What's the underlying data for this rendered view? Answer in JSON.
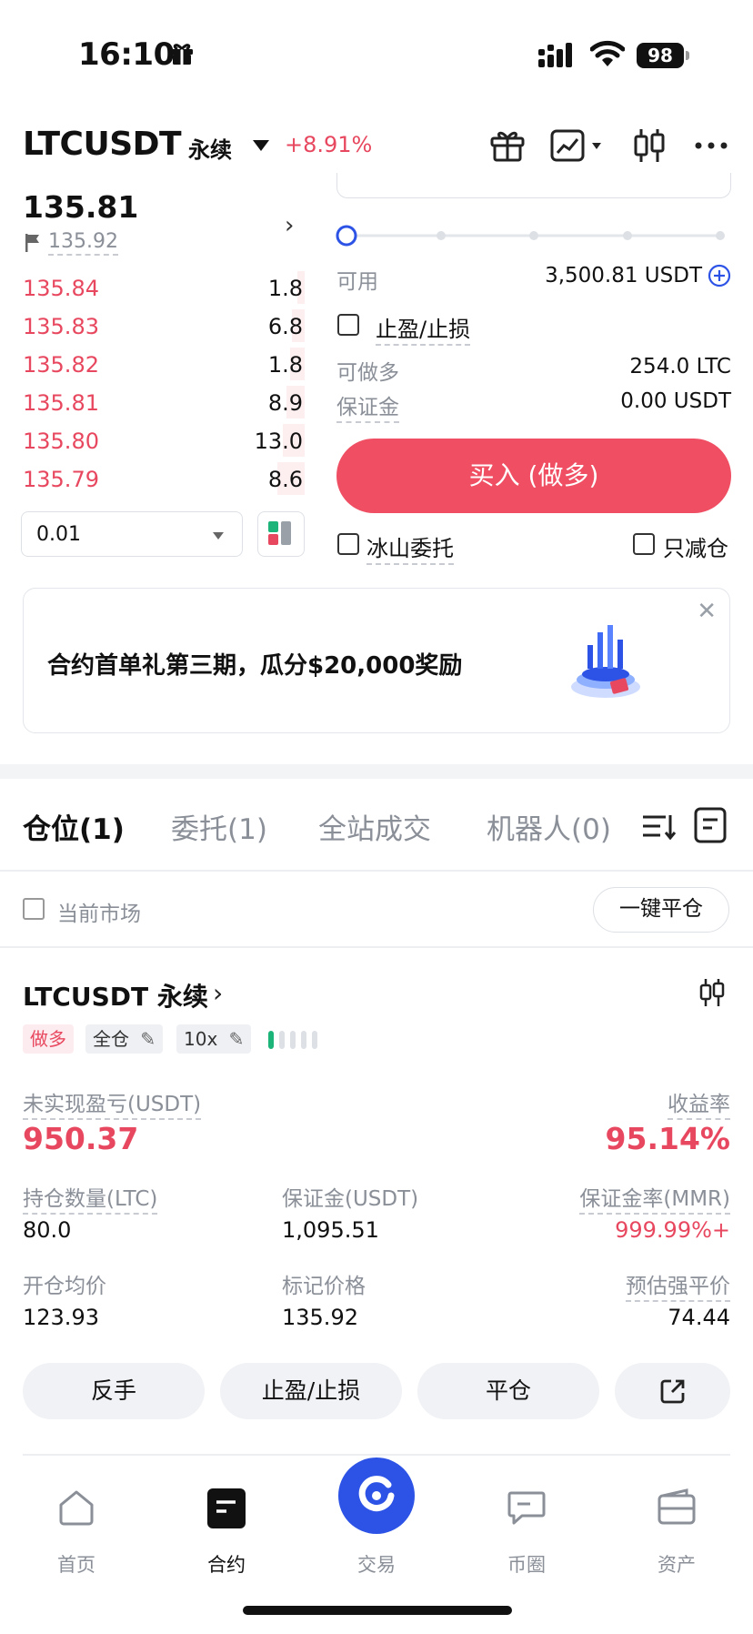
{
  "status_bar": {
    "time": "16:10",
    "battery": "98"
  },
  "header": {
    "pair": "LTCUSDT",
    "contract_type": "永续",
    "change": "+8.91%"
  },
  "orderbook": {
    "last_price": "135.81",
    "mark_price": "135.92",
    "asks": [
      {
        "price": "135.84",
        "qty": "1.8"
      },
      {
        "price": "135.83",
        "qty": "6.8"
      },
      {
        "price": "135.82",
        "qty": "1.8"
      },
      {
        "price": "135.81",
        "qty": "8.9"
      },
      {
        "price": "135.80",
        "qty": "13.0"
      },
      {
        "price": "135.79",
        "qty": "8.6"
      }
    ],
    "precision": "0.01"
  },
  "order_form": {
    "slider_percent": 0,
    "available_label": "可用",
    "available_value": "3,500.81 USDT",
    "tpsl_label": "止盈/止损",
    "max_long_label": "可做多",
    "max_long_value": "254.0 LTC",
    "margin_label": "保证金",
    "margin_value": "0.00 USDT",
    "buy_button": "买入 (做多)",
    "iceberg_label": "冰山委托",
    "reduce_only_label": "只减仓"
  },
  "banner": {
    "text": "合约首单礼第三期，瓜分$20,000奖励"
  },
  "tabs": [
    "仓位(1)",
    "委托(1)",
    "全站成交",
    "机器人(0)"
  ],
  "filter": {
    "current_market_label": "当前市场",
    "close_all_button": "一键平仓"
  },
  "position": {
    "title": "LTCUSDT 永续",
    "tags": {
      "side": "做多",
      "margin_mode": "全仓",
      "leverage": "10x"
    },
    "risk_level": 0.2,
    "upnl_label": "未实现盈亏(USDT)",
    "upnl_value": "950.37",
    "roe_label": "收益率",
    "roe_value": "95.14%",
    "size_label": "持仓数量(LTC)",
    "size_value": "80.0",
    "margin_label": "保证金(USDT)",
    "margin_value": "1,095.51",
    "mmr_label": "保证金率(MMR)",
    "mmr_value": "999.99%+",
    "entry_label": "开仓均价",
    "entry_value": "123.93",
    "mark_label": "标记价格",
    "mark_value": "135.92",
    "liq_label": "预估强平价",
    "liq_value": "74.44",
    "actions": {
      "reverse": "反手",
      "tpsl": "止盈/止损",
      "close": "平仓"
    }
  },
  "bottom_nav": [
    {
      "label": "首页",
      "icon": "home-icon"
    },
    {
      "label": "合约",
      "icon": "futures-icon"
    },
    {
      "label": "交易",
      "icon": "trade-icon"
    },
    {
      "label": "币圈",
      "icon": "community-icon"
    },
    {
      "label": "资产",
      "icon": "wallet-icon"
    }
  ],
  "colors": {
    "red": "#e8485f",
    "buy": "#ef4e63",
    "accent": "#2c53e6",
    "green": "#1db47a"
  }
}
